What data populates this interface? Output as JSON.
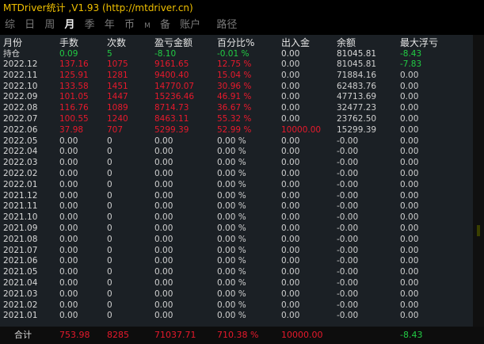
{
  "title": "MTDriver统计 ,V1.93 (http://mtdriver.cn)",
  "nav": [
    "综",
    "日",
    "周",
    "月",
    "季",
    "年",
    "币",
    "M",
    "备",
    "账户",
    "路径"
  ],
  "headers": [
    "月份",
    "手数",
    "次数",
    "盈亏金额",
    "百分比%",
    "出入金",
    "余额",
    "最大浮亏"
  ],
  "holding": {
    "label": "持仓",
    "lots": "0.09",
    "count": "5",
    "pnl": "-8.10",
    "pct": "-0.01 %",
    "io": "0.00",
    "balance": "81045.81",
    "maxdd": "-8.43"
  },
  "rows": [
    [
      "2022.12",
      "137.16",
      "1075",
      "9161.65",
      "12.75 %",
      "0.00",
      "81045.81",
      "-7.83"
    ],
    [
      "2022.11",
      "125.91",
      "1281",
      "9400.40",
      "15.04 %",
      "0.00",
      "71884.16",
      "0.00"
    ],
    [
      "2022.10",
      "133.58",
      "1451",
      "14770.07",
      "30.96 %",
      "0.00",
      "62483.76",
      "0.00"
    ],
    [
      "2022.09",
      "101.05",
      "1447",
      "15236.46",
      "46.91 %",
      "0.00",
      "47713.69",
      "0.00"
    ],
    [
      "2022.08",
      "116.76",
      "1089",
      "8714.73",
      "36.67 %",
      "0.00",
      "32477.23",
      "0.00"
    ],
    [
      "2022.07",
      "100.55",
      "1240",
      "8463.11",
      "55.32 %",
      "0.00",
      "23762.50",
      "0.00"
    ],
    [
      "2022.06",
      "37.98",
      "707",
      "5299.39",
      "52.99 %",
      "10000.00",
      "15299.39",
      "0.00"
    ],
    [
      "2022.05",
      "0.00",
      "0",
      "0.00",
      "0.00 %",
      "0.00",
      "-0.00",
      "0.00"
    ],
    [
      "2022.04",
      "0.00",
      "0",
      "0.00",
      "0.00 %",
      "0.00",
      "-0.00",
      "0.00"
    ],
    [
      "2022.03",
      "0.00",
      "0",
      "0.00",
      "0.00 %",
      "0.00",
      "-0.00",
      "0.00"
    ],
    [
      "2022.02",
      "0.00",
      "0",
      "0.00",
      "0.00 %",
      "0.00",
      "-0.00",
      "0.00"
    ],
    [
      "2022.01",
      "0.00",
      "0",
      "0.00",
      "0.00 %",
      "0.00",
      "-0.00",
      "0.00"
    ],
    [
      "2021.12",
      "0.00",
      "0",
      "0.00",
      "0.00 %",
      "0.00",
      "-0.00",
      "0.00"
    ],
    [
      "2021.11",
      "0.00",
      "0",
      "0.00",
      "0.00 %",
      "0.00",
      "-0.00",
      "0.00"
    ],
    [
      "2021.10",
      "0.00",
      "0",
      "0.00",
      "0.00 %",
      "0.00",
      "-0.00",
      "0.00"
    ],
    [
      "2021.09",
      "0.00",
      "0",
      "0.00",
      "0.00 %",
      "0.00",
      "-0.00",
      "0.00"
    ],
    [
      "2021.08",
      "0.00",
      "0",
      "0.00",
      "0.00 %",
      "0.00",
      "-0.00",
      "0.00"
    ],
    [
      "2021.07",
      "0.00",
      "0",
      "0.00",
      "0.00 %",
      "0.00",
      "-0.00",
      "0.00"
    ],
    [
      "2021.06",
      "0.00",
      "0",
      "0.00",
      "0.00 %",
      "0.00",
      "-0.00",
      "0.00"
    ],
    [
      "2021.05",
      "0.00",
      "0",
      "0.00",
      "0.00 %",
      "0.00",
      "-0.00",
      "0.00"
    ],
    [
      "2021.04",
      "0.00",
      "0",
      "0.00",
      "0.00 %",
      "0.00",
      "-0.00",
      "0.00"
    ],
    [
      "2021.03",
      "0.00",
      "0",
      "0.00",
      "0.00 %",
      "0.00",
      "-0.00",
      "0.00"
    ],
    [
      "2021.02",
      "0.00",
      "0",
      "0.00",
      "0.00 %",
      "0.00",
      "-0.00",
      "0.00"
    ],
    [
      "2021.01",
      "0.00",
      "0",
      "0.00",
      "0.00 %",
      "0.00",
      "-0.00",
      "0.00"
    ]
  ],
  "total": {
    "label": "合计",
    "lots": "753.98",
    "count": "8285",
    "pnl": "71037.71",
    "pct": "710.38 %",
    "io": "10000.00",
    "maxdd": "-8.43"
  },
  "colors": {
    "title": "#f0c000",
    "profit": "#e8192c",
    "loss": "#22cc44",
    "text": "#d8d8d8",
    "table_bg": "#1b2025"
  }
}
